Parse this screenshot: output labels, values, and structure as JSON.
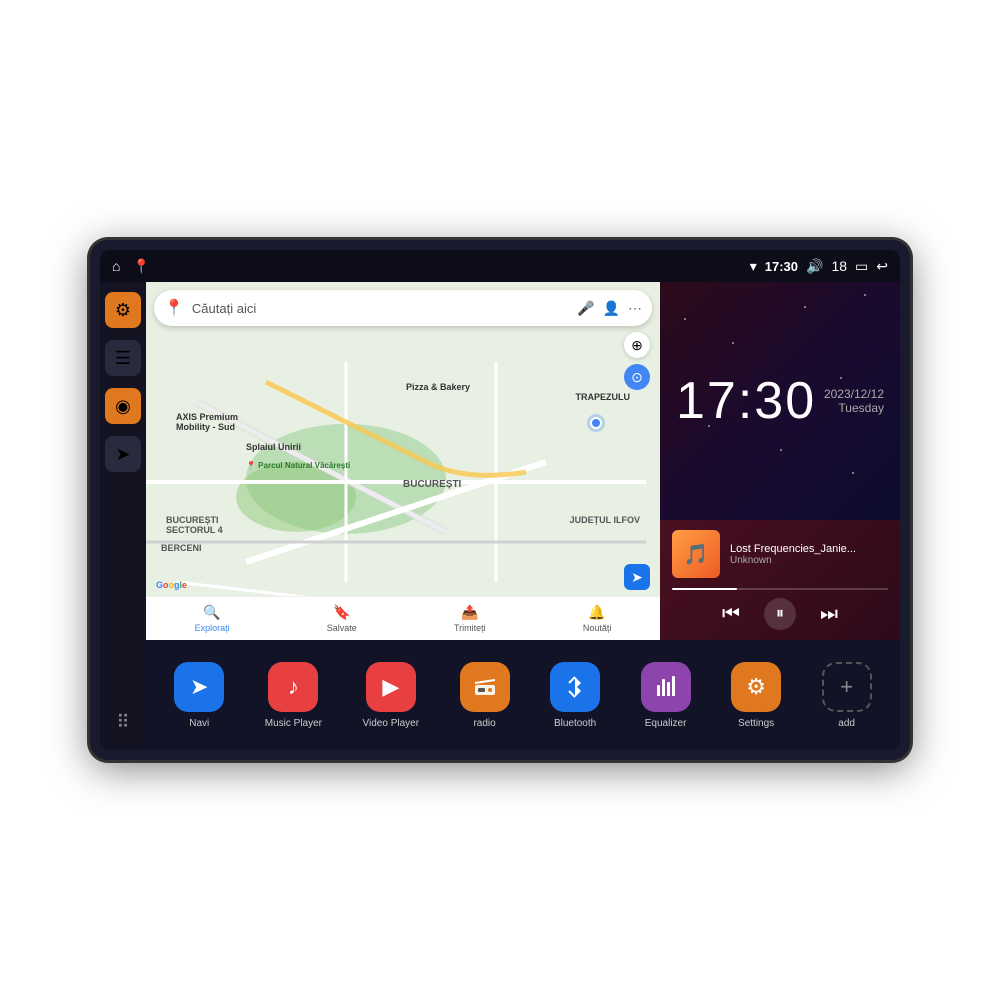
{
  "device": {
    "status_bar": {
      "wifi_icon": "▾",
      "time": "17:30",
      "volume_icon": "🔊",
      "battery_num": "18",
      "battery_icon": "▭",
      "back_icon": "↩"
    },
    "sidebar": {
      "home_icon": "⌂",
      "location_icon": "📍",
      "settings_icon": "⚙",
      "menu_icon": "☰",
      "map_icon": "◉",
      "nav_icon": "➤",
      "grid_icon": "⠿"
    },
    "map": {
      "search_placeholder": "Căutați aici",
      "locations": [
        "AXIS Premium Mobility - Sud",
        "Parcul Natural Văcărești",
        "Pizza & Bakery",
        "TRAPEZULU",
        "BUCUREȘTI",
        "BUCUREȘTI SECTORUL 4",
        "BERCENI",
        "JUDEȚUL ILFOV"
      ],
      "bottom_nav": [
        {
          "label": "Explorați",
          "icon": "📍",
          "active": true
        },
        {
          "label": "Salvate",
          "icon": "🔖",
          "active": false
        },
        {
          "label": "Trimiteți",
          "icon": "📤",
          "active": false
        },
        {
          "label": "Noutăți",
          "icon": "🔔",
          "active": false
        }
      ]
    },
    "clock": {
      "time": "17:30",
      "date": "2023/12/12",
      "day": "Tuesday"
    },
    "music": {
      "track_name": "Lost Frequencies_Janie...",
      "artist": "Unknown",
      "progress": 30,
      "prev_icon": "⏮",
      "play_icon": "⏸",
      "next_icon": "⏭"
    },
    "apps": [
      {
        "id": "navi",
        "label": "Navi",
        "icon": "➤",
        "color": "icon-navi"
      },
      {
        "id": "music-player",
        "label": "Music Player",
        "icon": "♪",
        "color": "icon-music"
      },
      {
        "id": "video-player",
        "label": "Video Player",
        "icon": "▶",
        "color": "icon-video"
      },
      {
        "id": "radio",
        "label": "radio",
        "icon": "📻",
        "color": "icon-radio"
      },
      {
        "id": "bluetooth",
        "label": "Bluetooth",
        "icon": "⚡",
        "color": "icon-bluetooth"
      },
      {
        "id": "equalizer",
        "label": "Equalizer",
        "icon": "🎚",
        "color": "icon-equalizer"
      },
      {
        "id": "settings",
        "label": "Settings",
        "icon": "⚙",
        "color": "icon-settings"
      },
      {
        "id": "add",
        "label": "add",
        "icon": "+",
        "color": "icon-add"
      }
    ]
  }
}
